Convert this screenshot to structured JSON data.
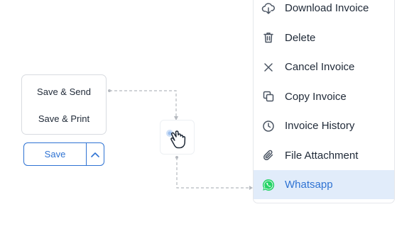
{
  "save_dropdown": {
    "options": [
      "Save & Send",
      "Save & Print"
    ],
    "save_label": "Save"
  },
  "action_menu": {
    "items": [
      {
        "label": "Download Invoice",
        "icon": "cloud-download-icon"
      },
      {
        "label": "Delete",
        "icon": "trash-icon"
      },
      {
        "label": "Cancel Invoice",
        "icon": "close-icon"
      },
      {
        "label": "Copy Invoice",
        "icon": "copy-icon"
      },
      {
        "label": "Invoice History",
        "icon": "clock-icon"
      },
      {
        "label": "File Attachment",
        "icon": "paperclip-icon"
      },
      {
        "label": "Whatsapp",
        "icon": "whatsapp-icon",
        "active": true
      }
    ]
  },
  "colors": {
    "accent": "#2f73d3",
    "active_bg": "#e1ecfa",
    "whatsapp": "#25d366",
    "icon": "#4b5563",
    "connector": "#b5b9bf"
  }
}
